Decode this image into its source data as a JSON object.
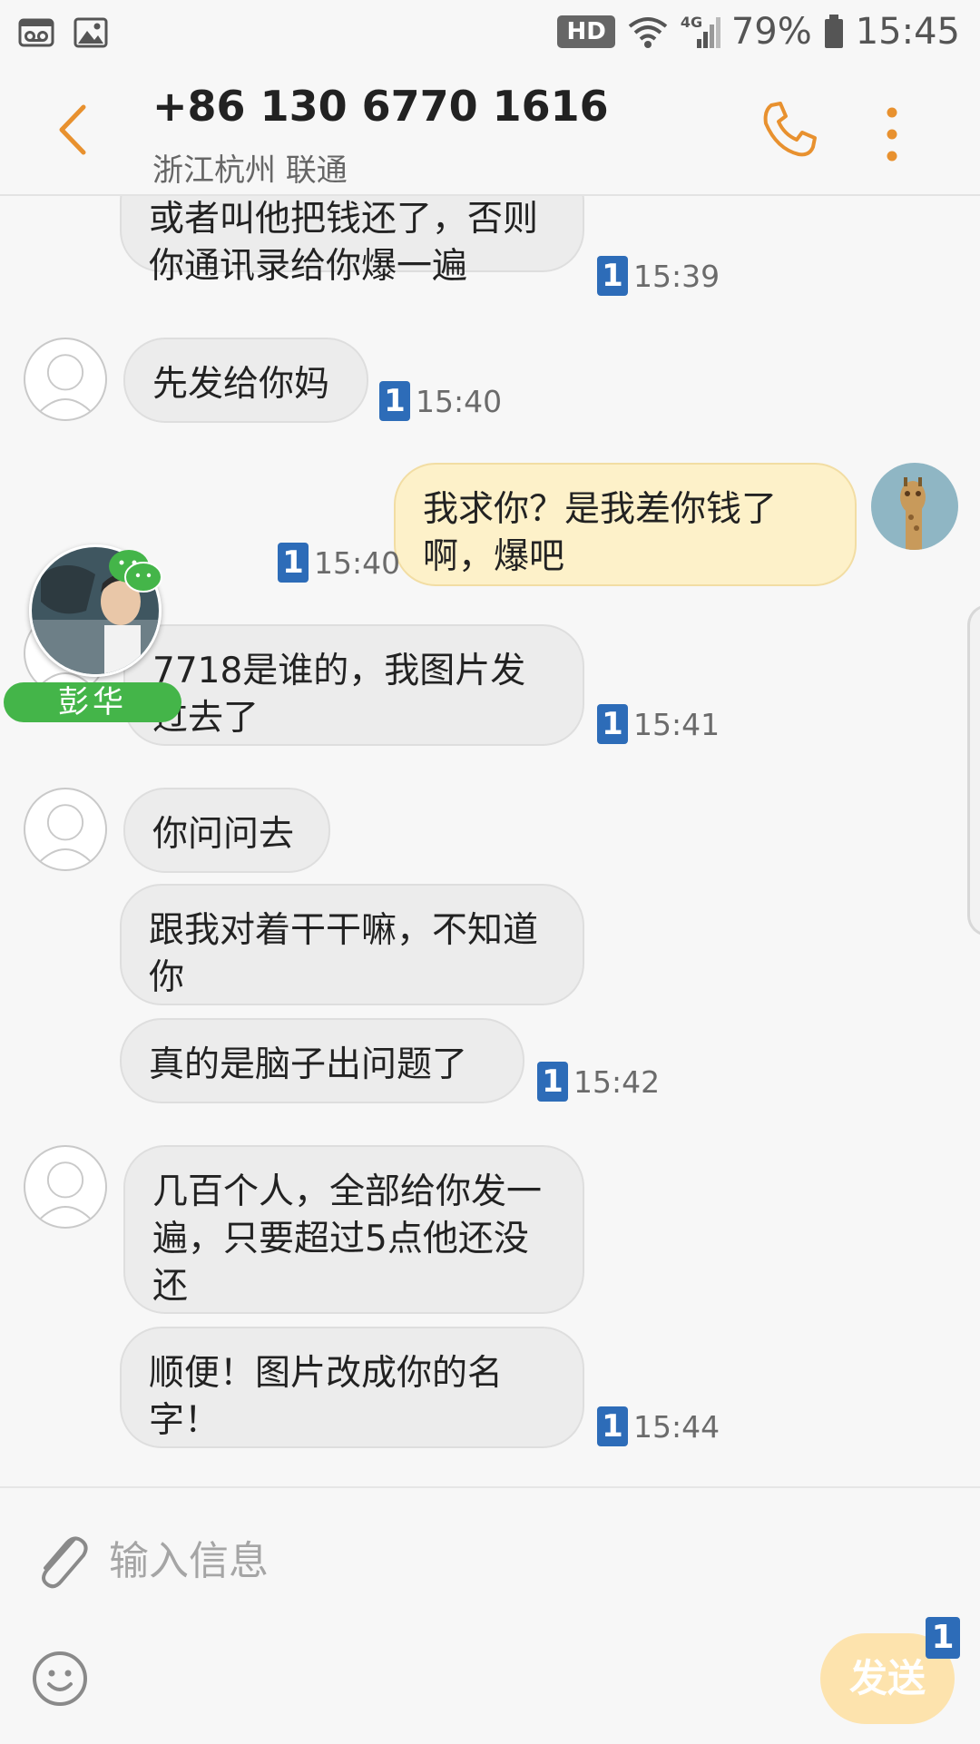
{
  "status_bar": {
    "left_icons": [
      "voicemail-icon",
      "image-icon"
    ],
    "hd": "HD",
    "network": "4G",
    "battery": "79%",
    "time": "15:45"
  },
  "header": {
    "title": "+86 130 6770 1616",
    "subtitle": "浙江杭州 联通",
    "back_icon": "chevron-left-icon",
    "call_icon": "phone-icon",
    "more_icon": "more-vertical-icon",
    "accent": "#e8912f"
  },
  "messages": [
    {
      "dir": "in",
      "text": "或者叫他把钱还了，否则你通讯录给你爆一遍",
      "sim": "1",
      "time": "15:39"
    },
    {
      "dir": "in",
      "text": "先发给你妈",
      "sim": "1",
      "time": "15:40"
    },
    {
      "dir": "out",
      "text": "我求你？是我差你钱了啊，爆吧",
      "sim": "1",
      "time": "15:40"
    },
    {
      "dir": "in",
      "text": "7718是谁的，我图片发过去了",
      "sim": "1",
      "time": "15:41"
    },
    {
      "dir": "in",
      "text": "你问问去"
    },
    {
      "dir": "in",
      "text": "跟我对着干干嘛，不知道你"
    },
    {
      "dir": "in",
      "text": "真的是脑子出问题了",
      "sim": "1",
      "time": "15:42"
    },
    {
      "dir": "in",
      "text": "几百个人，全部给你发一遍，只要超过5点他还没还"
    },
    {
      "dir": "in",
      "text": "顺便！图片改成你的名字！",
      "sim": "1",
      "time": "15:44"
    }
  ],
  "floating_bubble": {
    "name": "彭华",
    "badge_color": "#44b549"
  },
  "composer": {
    "placeholder": "输入信息",
    "send_label": "发送",
    "send_sim": "1",
    "attach_icon": "paperclip-icon",
    "emoji_icon": "smiley-icon"
  },
  "colors": {
    "incoming_bubble": "#ececec",
    "outgoing_bubble": "#fdf1c9",
    "sim_badge": "#2d6cb8"
  }
}
